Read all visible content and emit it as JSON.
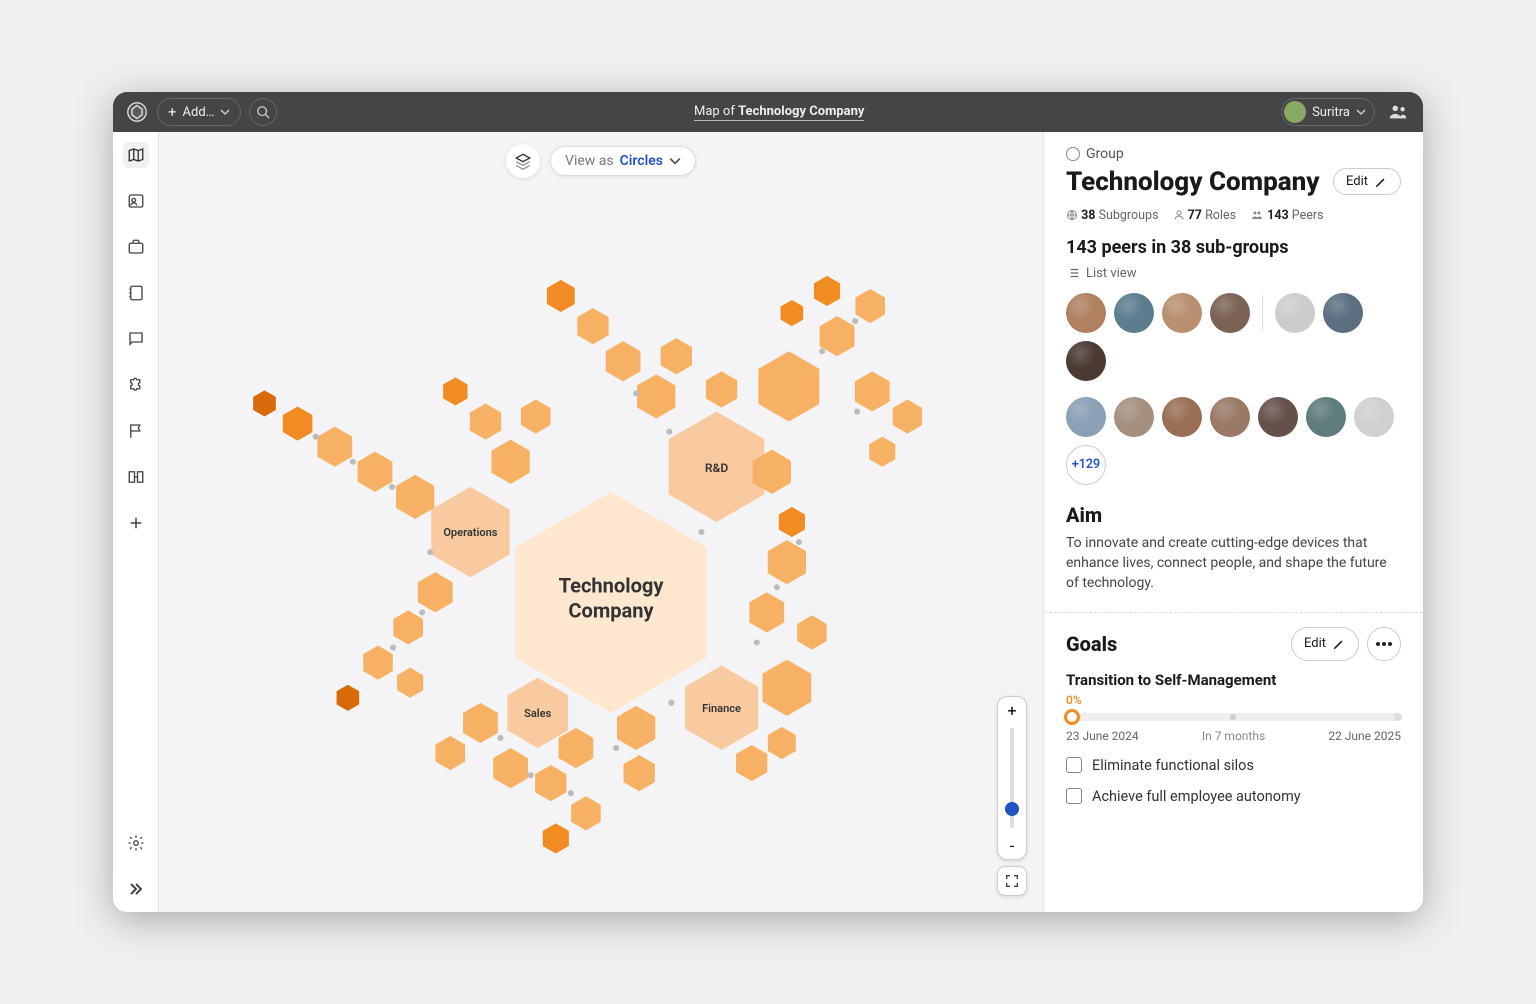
{
  "topbar": {
    "add_label": "Add…",
    "title_prefix": "Map of ",
    "title_name": "Technology Company",
    "user_name": "Suritra"
  },
  "view_control": {
    "view_as_label": "View as",
    "mode": "Circles"
  },
  "map": {
    "center": "Technology Company",
    "nodes": {
      "rd": "R&D",
      "operations": "Operations",
      "sales": "Sales",
      "finance": "Finance"
    }
  },
  "panel": {
    "type_label": "Group",
    "title": "Technology Company",
    "edit_label": "Edit",
    "subgroups_count": "38",
    "subgroups_label": "Subgroups",
    "roles_count": "77",
    "roles_label": "Roles",
    "peers_count": "143",
    "peers_label": "Peers",
    "peers_summary": "143 peers in 38 sub-groups",
    "list_view_label": "List view",
    "more_avatars": "+129",
    "aim_heading": "Aim",
    "aim_text": "To innovate and create cutting-edge devices that enhance lives, connect people, and shape the future of technology.",
    "goals_heading": "Goals",
    "goal": {
      "title": "Transition to Self-Management",
      "percent": "0%",
      "start": "23 June 2024",
      "mid": "In 7 months",
      "end": "22 June 2025",
      "sub1": "Eliminate functional silos",
      "sub2": "Achieve full employee autonomy"
    }
  },
  "avatar_colors": [
    "#b08060",
    "#5b7d8e",
    "#b89070",
    "#7a6254",
    "#ccc",
    "#5c6e80",
    "#4a3a32",
    "#8aa0b4",
    "#a59080",
    "#996f55",
    "#9a7a66",
    "#66514a",
    "#5e7b7d",
    "#d0d0d0"
  ]
}
